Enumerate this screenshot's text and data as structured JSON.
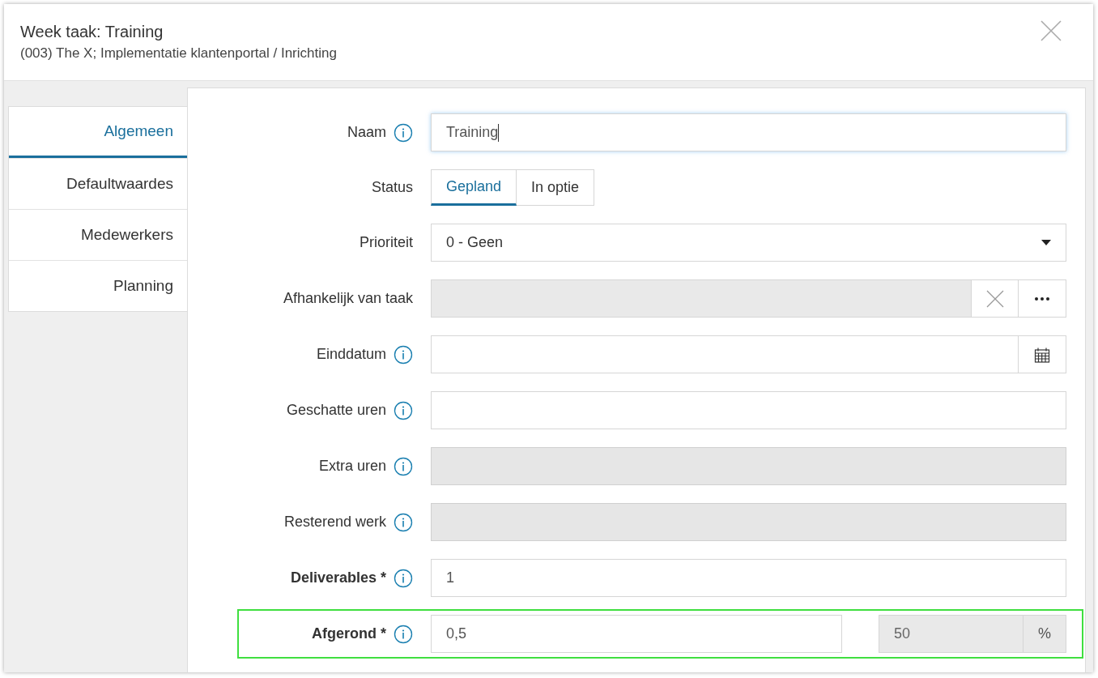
{
  "dialog": {
    "title": "Week taak: Training",
    "subtitle": "(003) The X; Implementatie klantenportal / Inrichting"
  },
  "tabs": [
    {
      "label": "Algemeen",
      "selected": true
    },
    {
      "label": "Defaultwaardes",
      "selected": false
    },
    {
      "label": "Medewerkers",
      "selected": false
    },
    {
      "label": "Planning",
      "selected": false
    }
  ],
  "fields": [
    {
      "kind": "text",
      "label": "Naam",
      "required": false,
      "info": true,
      "value": "Training",
      "disabled": false,
      "focused": true,
      "highlighted": false
    },
    {
      "kind": "toggle",
      "label": "Status",
      "required": false,
      "info": false,
      "options": [
        {
          "label": "Gepland",
          "selected": true
        },
        {
          "label": "In optie",
          "selected": false
        }
      ],
      "highlighted": false
    },
    {
      "kind": "select",
      "label": "Prioriteit",
      "required": false,
      "info": false,
      "value": "0 - Geen",
      "highlighted": false
    },
    {
      "kind": "lookup",
      "label": "Afhankelijk van taak",
      "required": false,
      "info": false,
      "disabled": true,
      "highlighted": false
    },
    {
      "kind": "date",
      "label": "Einddatum",
      "required": false,
      "info": true,
      "highlighted": false
    },
    {
      "kind": "text",
      "label": "Geschatte uren",
      "required": false,
      "info": true,
      "disabled": false,
      "focused": false,
      "highlighted": false
    },
    {
      "kind": "text",
      "label": "Extra uren",
      "required": false,
      "info": true,
      "disabled": true,
      "focused": false,
      "highlighted": false
    },
    {
      "kind": "text",
      "label": "Resterend werk",
      "required": false,
      "info": true,
      "disabled": true,
      "focused": false,
      "highlighted": false
    },
    {
      "kind": "text",
      "label": "Deliverables *",
      "required": true,
      "info": true,
      "value": "1",
      "disabled": false,
      "focused": false,
      "highlighted": false
    },
    {
      "kind": "percent",
      "label": "Afgerond *",
      "required": true,
      "info": true,
      "value": "0,5",
      "percent": "50",
      "unit": "%",
      "highlighted": true
    }
  ]
}
